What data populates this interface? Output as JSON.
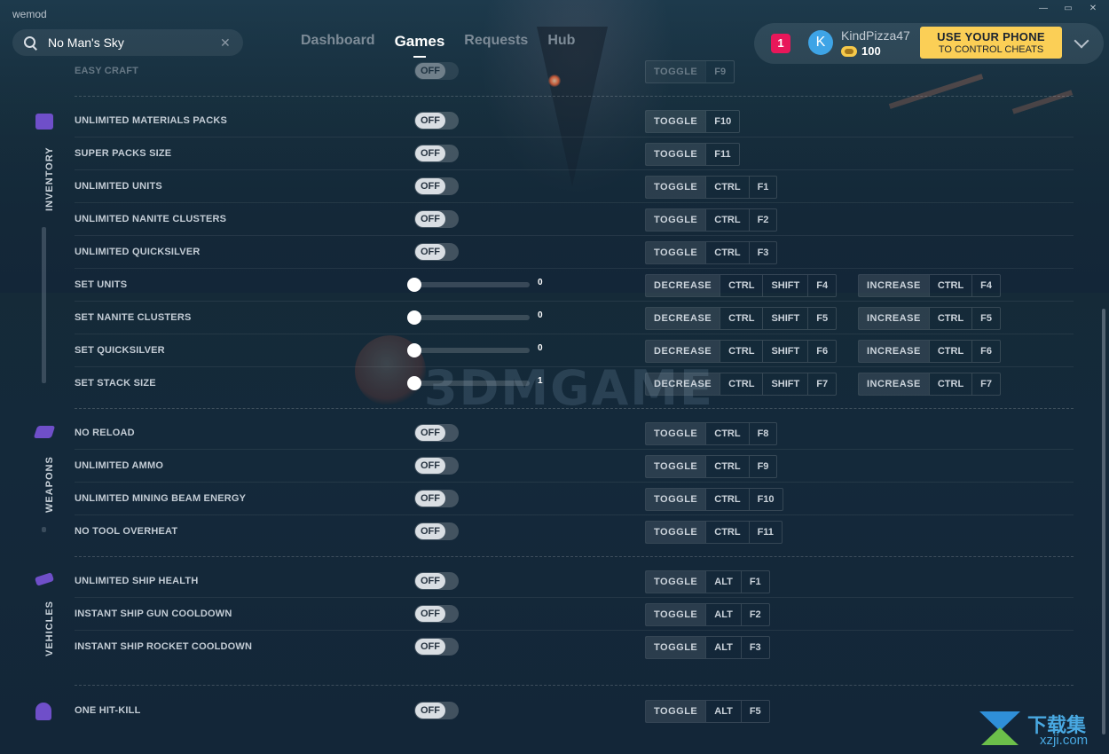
{
  "app": {
    "brand": "wemod"
  },
  "window_controls": {
    "minimize": "—",
    "maximize": "▭",
    "close": "✕"
  },
  "search": {
    "value": "No Man's Sky",
    "clear": "✕"
  },
  "nav": {
    "tabs": [
      {
        "label": "Dashboard"
      },
      {
        "label": "Games"
      },
      {
        "label": "Requests"
      },
      {
        "label": "Hub"
      }
    ]
  },
  "account": {
    "notifications": "1",
    "avatar_letter": "K",
    "username": "KindPizza47",
    "coins": "100",
    "phone_button": {
      "line1": "USE YOUR PHONE",
      "line2": "TO CONTROL CHEATS"
    }
  },
  "colors": {
    "accent": "#fbcf56",
    "notification": "#e8175a",
    "avatar": "#3ea4e6",
    "category_icon": "#6f4fc9"
  },
  "categories": [
    {
      "label": "INVENTORY"
    },
    {
      "label": "WEAPONS"
    },
    {
      "label": "VEHICLES"
    }
  ],
  "toggle_state": "OFF",
  "labels": {
    "toggle": "TOGGLE",
    "decrease": "DECREASE",
    "increase": "INCREASE"
  },
  "cheats": [
    {
      "name": "EASY CRAFT",
      "keys": [
        "F9"
      ]
    },
    {
      "name": "UNLIMITED MATERIALS PACKS",
      "keys": [
        "F10"
      ]
    },
    {
      "name": "SUPER PACKS SIZE",
      "keys": [
        "F11"
      ]
    },
    {
      "name": "UNLIMITED UNITS",
      "keys": [
        "CTRL",
        "F1"
      ]
    },
    {
      "name": "UNLIMITED NANITE CLUSTERS",
      "keys": [
        "CTRL",
        "F2"
      ]
    },
    {
      "name": "UNLIMITED QUICKSILVER",
      "keys": [
        "CTRL",
        "F3"
      ]
    },
    {
      "name": "SET UNITS",
      "value": "0",
      "dec_keys": [
        "CTRL",
        "SHIFT",
        "F4"
      ],
      "inc_keys": [
        "CTRL",
        "F4"
      ]
    },
    {
      "name": "SET NANITE CLUSTERS",
      "value": "0",
      "dec_keys": [
        "CTRL",
        "SHIFT",
        "F5"
      ],
      "inc_keys": [
        "CTRL",
        "F5"
      ]
    },
    {
      "name": "SET QUICKSILVER",
      "value": "0",
      "dec_keys": [
        "CTRL",
        "SHIFT",
        "F6"
      ],
      "inc_keys": [
        "CTRL",
        "F6"
      ]
    },
    {
      "name": "SET STACK SIZE",
      "value": "1",
      "dec_keys": [
        "CTRL",
        "SHIFT",
        "F7"
      ],
      "inc_keys": [
        "CTRL",
        "F7"
      ]
    },
    {
      "name": "NO RELOAD",
      "keys": [
        "CTRL",
        "F8"
      ]
    },
    {
      "name": "UNLIMITED AMMO",
      "keys": [
        "CTRL",
        "F9"
      ]
    },
    {
      "name": "UNLIMITED MINING BEAM ENERGY",
      "keys": [
        "CTRL",
        "F10"
      ]
    },
    {
      "name": "NO TOOL OVERHEAT",
      "keys": [
        "CTRL",
        "F11"
      ]
    },
    {
      "name": "UNLIMITED SHIP HEALTH",
      "keys": [
        "ALT",
        "F1"
      ]
    },
    {
      "name": "INSTANT SHIP GUN COOLDOWN",
      "keys": [
        "ALT",
        "F2"
      ]
    },
    {
      "name": "INSTANT SHIP ROCKET COOLDOWN",
      "keys": [
        "ALT",
        "F3"
      ]
    },
    {
      "name": "ONE HIT-KILL",
      "keys": [
        "ALT",
        "F5"
      ]
    }
  ],
  "watermark": "3DMGAME",
  "site_logo": {
    "title": "下载集",
    "domain": "xzji.com"
  }
}
